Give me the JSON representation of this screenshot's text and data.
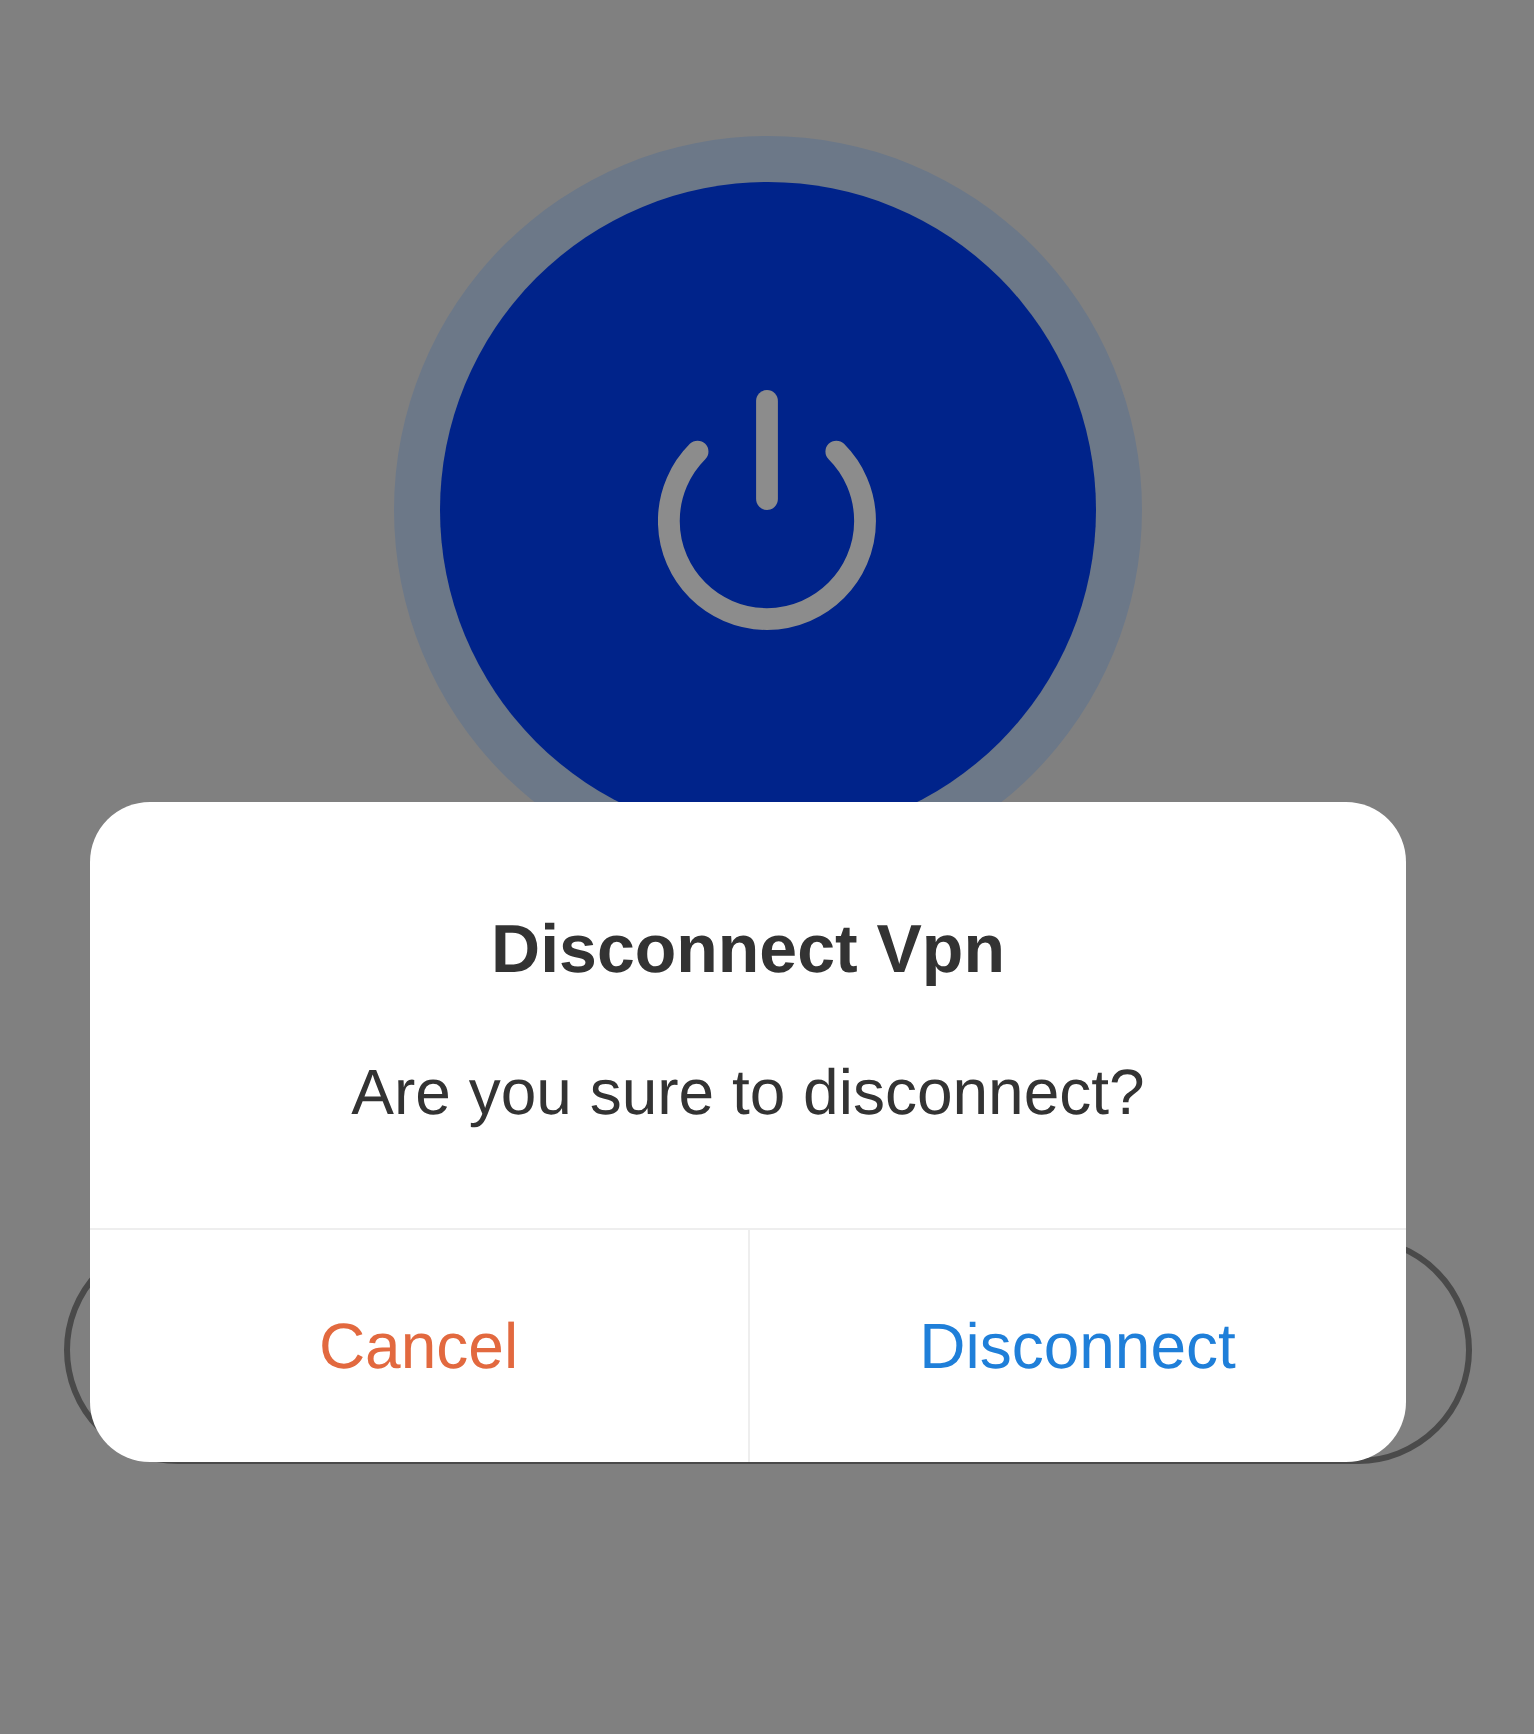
{
  "dialog": {
    "title": "Disconnect Vpn",
    "message": "Are you sure to disconnect?",
    "buttons": [
      {
        "label": "Cancel",
        "kind": "cancel"
      },
      {
        "label": "Disconnect",
        "kind": "confirm"
      }
    ]
  }
}
